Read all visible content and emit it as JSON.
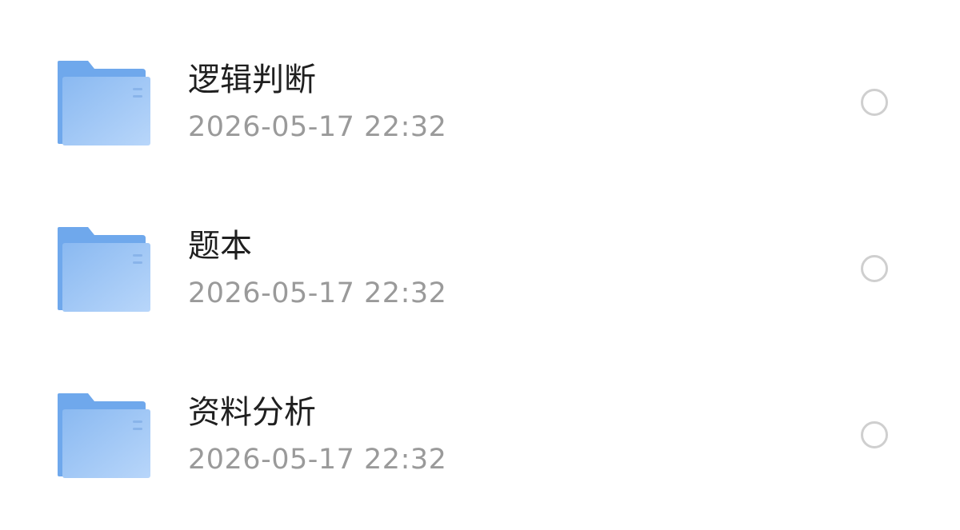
{
  "folders": [
    {
      "name": "逻辑判断",
      "modified": "2026-05-17 22:32",
      "selected": false
    },
    {
      "name": "题本",
      "modified": "2026-05-17 22:32",
      "selected": false
    },
    {
      "name": "资料分析",
      "modified": "2026-05-17 22:32",
      "selected": false
    }
  ],
  "icon": "folder-icon",
  "colors": {
    "folder_back": "#6fa8ec",
    "folder_front_start": "#8ab9f1",
    "folder_front_end": "#b8d6fa",
    "title": "#1f1f1f",
    "time": "#9a9a9a",
    "radio_border": "#cfcfcf"
  }
}
